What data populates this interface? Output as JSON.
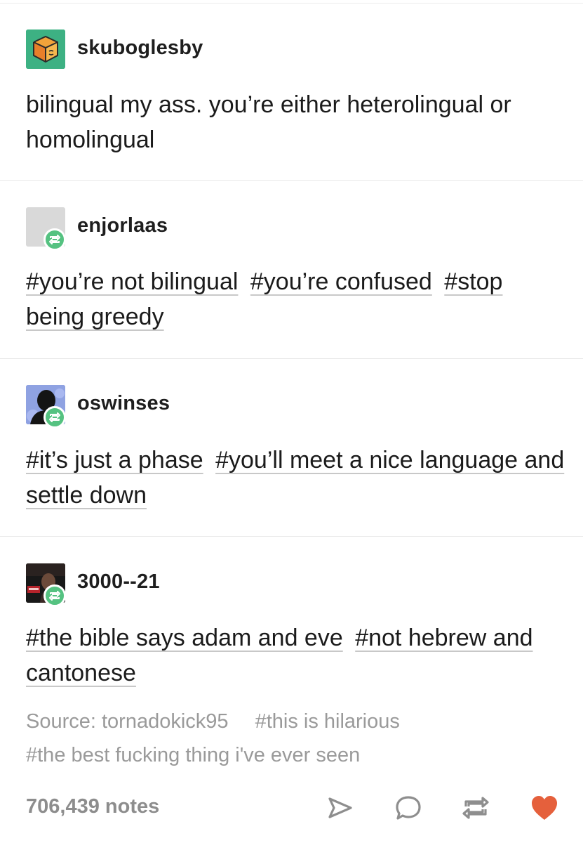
{
  "posts": [
    {
      "username": "skuboglesby",
      "avatar_icon": "cube-avatar-icon",
      "text": "bilingual my ass. you’re either heterolingual or homolingual"
    },
    {
      "username": "enjorlaas",
      "avatar_icon": "blank-avatar-icon",
      "reblog_icon": "reblog-badge-icon",
      "tags": [
        "#you’re not bilingual",
        "#you’re confused",
        "#stop being greedy"
      ]
    },
    {
      "username": "oswinses",
      "avatar_icon": "silhouette-avatar-icon",
      "reblog_icon": "reblog-badge-icon",
      "tags": [
        "#it’s just a phase",
        "#you’ll meet a nice language and settle down"
      ]
    },
    {
      "username": "3000--21",
      "avatar_icon": "photo-avatar-icon",
      "reblog_icon": "reblog-badge-icon",
      "tags": [
        "#the bible says adam and eve",
        "#not hebrew and cantonese"
      ]
    }
  ],
  "footer": {
    "source": "Source: tornadokick95",
    "tags": [
      "#this is hilarious",
      "#the best fucking thing i've ever seen"
    ],
    "notes": "706,439 notes",
    "actions": {
      "share_icon": "share-icon",
      "reply_icon": "reply-icon",
      "reblog_icon": "reblog-icon",
      "like_icon": "heart-icon"
    }
  },
  "colors": {
    "reblog_badge": "#55c281",
    "like": "#e5603c",
    "meta_text": "#9a9a9a",
    "divider": "#e8e8e8"
  }
}
